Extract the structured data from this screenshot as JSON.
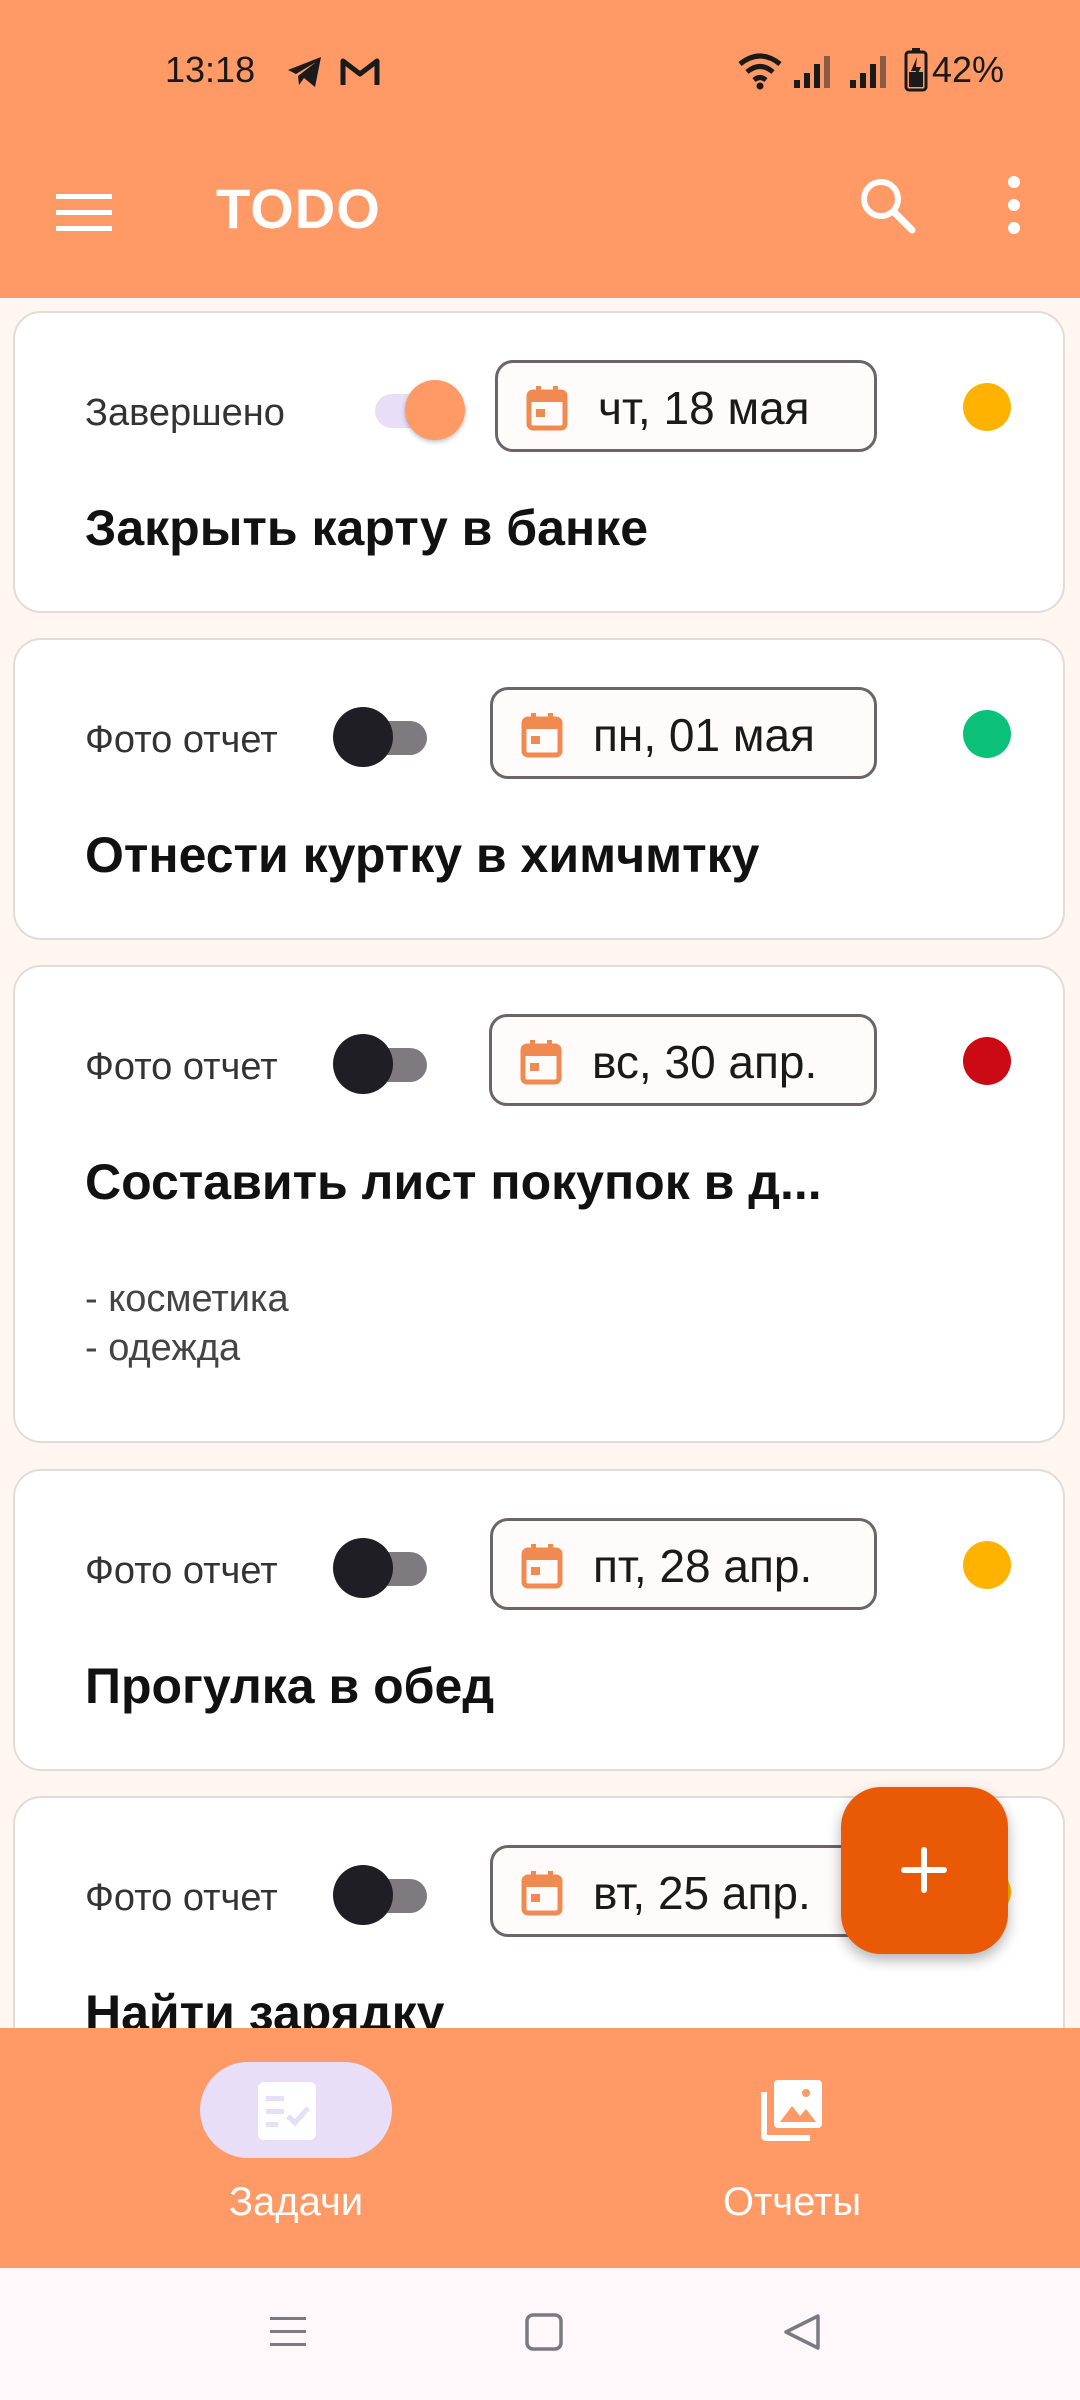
{
  "status_bar": {
    "time": "13:18",
    "battery": "42%",
    "notification_icons": [
      "telegram-icon",
      "gmail-icon"
    ],
    "system_icons": [
      "wifi-icon",
      "signal-icon",
      "signal-icon",
      "battery-charging-icon"
    ]
  },
  "app_bar": {
    "title": "TODO",
    "background": "#FF9966"
  },
  "tasks": [
    {
      "toggle_label": "Завершено",
      "toggle_on": true,
      "date": "чт, 18 мая",
      "priority_color": "#FFB300",
      "title": "Закрыть карту в банке",
      "description": []
    },
    {
      "toggle_label": "Фото отчет",
      "toggle_on": false,
      "date": "пн, 01 мая",
      "priority_color": "#0BC17A",
      "title": "Отнести куртку в химчмтку",
      "description": []
    },
    {
      "toggle_label": "Фото отчет",
      "toggle_on": false,
      "date": "вс, 30 апр.",
      "priority_color": "#CC0A14",
      "title": "Составить лист покупок в д...",
      "description": [
        "- косметика",
        "- одежда"
      ]
    },
    {
      "toggle_label": "Фото отчет",
      "toggle_on": false,
      "date": "пт, 28 апр.",
      "priority_color": "#FFB300",
      "title": "Прогулка в обед",
      "description": []
    },
    {
      "toggle_label": "Фото отчет",
      "toggle_on": false,
      "date": "вт, 25 апр.",
      "priority_color": "#FFB300",
      "title": "Найти зарядку",
      "description": []
    }
  ],
  "fab": {
    "icon": "plus-icon",
    "color": "#EA5A06"
  },
  "bottom_nav": {
    "items": [
      {
        "label": "Задачи",
        "icon": "tasks-icon",
        "selected": true
      },
      {
        "label": "Отчеты",
        "icon": "photo-library-icon",
        "selected": false
      }
    ]
  },
  "system_nav": [
    "recents-icon",
    "home-icon",
    "back-icon"
  ]
}
